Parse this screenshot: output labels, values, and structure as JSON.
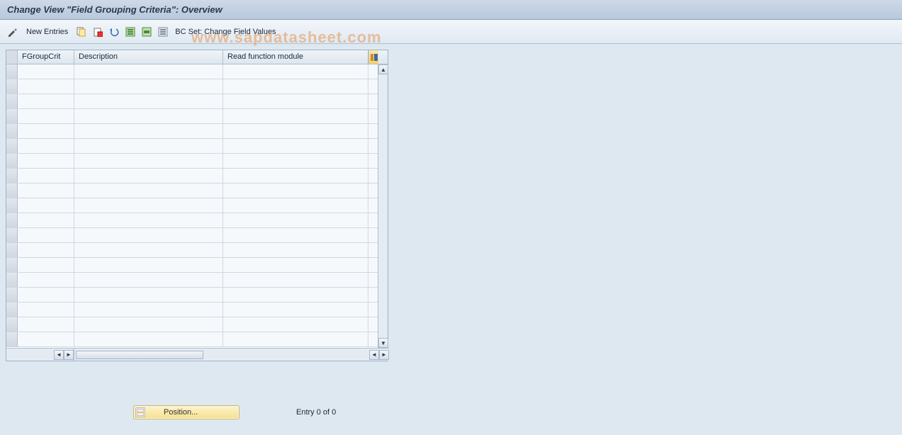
{
  "titlebar": {
    "title": "Change View \"Field Grouping Criteria\": Overview"
  },
  "toolbar": {
    "new_entries_label": "New Entries",
    "bcset_label": "BC Set: Change Field Values",
    "icons": {
      "switch_mode": "switch-mode-icon",
      "copy": "copy-icon",
      "delete": "delete-icon",
      "undo": "undo-icon",
      "select_all": "select-all-icon",
      "select_block": "select-block-icon",
      "deselect_all": "deselect-all-icon"
    }
  },
  "watermark": "www.sapdatasheet.com",
  "table": {
    "columns": {
      "c1": "FGroupCrit",
      "c2": "Description",
      "c3": "Read function module"
    },
    "config_icon": "table-settings-icon",
    "row_count": 19,
    "rows": []
  },
  "footer": {
    "position_label": "Position...",
    "entry_text": "Entry 0 of 0"
  }
}
